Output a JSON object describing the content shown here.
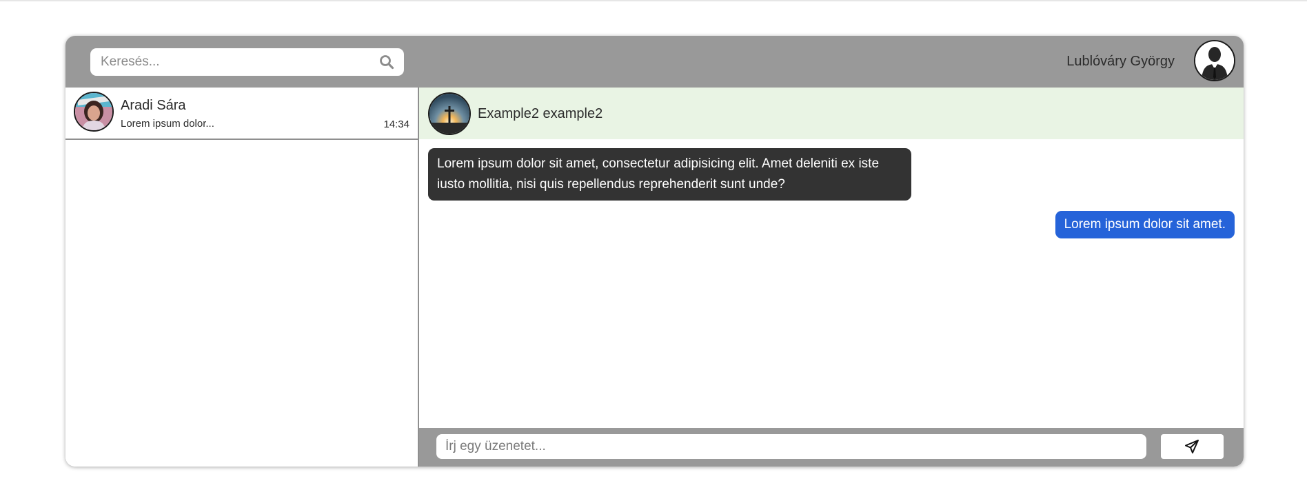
{
  "header": {
    "search_placeholder": "Keresés...",
    "search_icon": "search-icon",
    "user_name": "Lublóváry György",
    "user_avatar_icon": "person-silhouette-icon"
  },
  "sidebar": {
    "conversations": [
      {
        "name": "Aradi Sára",
        "preview": "Lorem ipsum dolor...",
        "time": "14:34"
      }
    ]
  },
  "chat": {
    "title": "Example2 example2",
    "messages": [
      {
        "direction": "incoming",
        "text": "Lorem ipsum dolor sit amet, consectetur adipisicing elit. Amet deleniti ex iste iusto mollitia, nisi quis repellendus reprehenderit sunt unde?"
      },
      {
        "direction": "outgoing",
        "text": "Lorem ipsum dolor sit amet."
      }
    ],
    "composer": {
      "placeholder": "Írj egy üzenetet...",
      "send_icon": "paper-plane-icon"
    }
  },
  "colors": {
    "header_bg": "#999999",
    "chat_header_bg": "#e9f4e4",
    "incoming_bubble": "#333333",
    "outgoing_bubble": "#2563d9"
  }
}
